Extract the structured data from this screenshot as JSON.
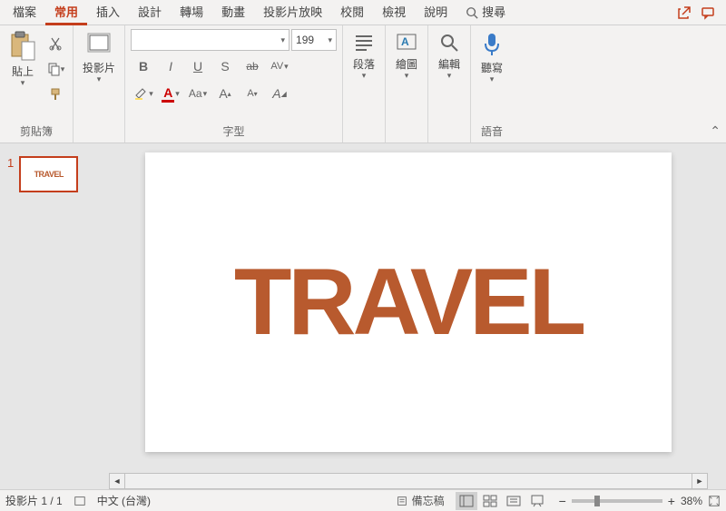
{
  "tabs": {
    "items": [
      "檔案",
      "常用",
      "插入",
      "設計",
      "轉場",
      "動畫",
      "投影片放映",
      "校閱",
      "檢視",
      "說明"
    ],
    "active_index": 1,
    "search_label": "搜尋"
  },
  "ribbon": {
    "clipboard": {
      "paste_label": "貼上",
      "group_label": "剪貼簿"
    },
    "slides": {
      "label": "投影片"
    },
    "font": {
      "size_value": "199",
      "group_label": "字型",
      "bold": "B",
      "italic": "I",
      "underline": "U",
      "shadow": "S",
      "strike": "ab",
      "spacing": "AV",
      "incsize": "A",
      "decsize": "A",
      "clear": "A"
    },
    "paragraph": {
      "label": "段落"
    },
    "drawing": {
      "label": "繪圖"
    },
    "editing": {
      "label": "編輯"
    },
    "voice": {
      "dictate_label": "聽寫",
      "group_label": "語音"
    }
  },
  "slide": {
    "thumb_number": "1",
    "text": "TRAVEL"
  },
  "status": {
    "slide_counter": "投影片 1 / 1",
    "language": "中文 (台灣)",
    "notes_label": "備忘稿",
    "zoom_minus": "−",
    "zoom_plus": "+",
    "zoom_value": "38%"
  }
}
